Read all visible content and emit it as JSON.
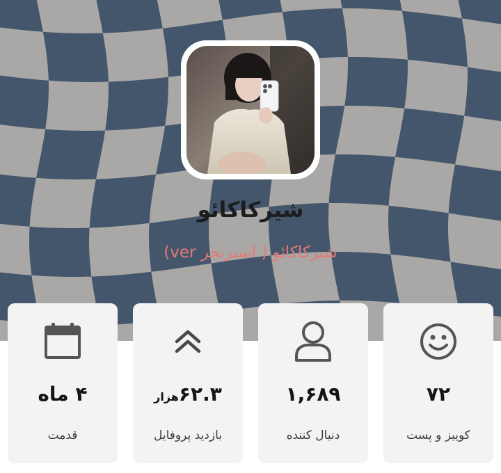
{
  "profile": {
    "name": "شیرکاکائو",
    "subtitle": "شیرکاکائو ( استرنجر ver)"
  },
  "stats": [
    {
      "icon": "smiley-icon",
      "value": "۷۲",
      "unit": "",
      "label": "کوییز و پست"
    },
    {
      "icon": "user-icon",
      "value": "۱,۶۸۹",
      "unit": "",
      "label": "دنبال کننده"
    },
    {
      "icon": "double-chevron-up-icon",
      "value": "۶۲.۳",
      "unit": "هزار",
      "label": "بازدید پروفایل"
    },
    {
      "icon": "calendar-icon",
      "value": "۴ ماه",
      "unit": "",
      "label": "قدمت"
    }
  ],
  "colors": {
    "checker_dark": "#44566b",
    "checker_light": "#a9a8a6",
    "subtitle": "#e47a76",
    "card": "#f3f3f3"
  }
}
